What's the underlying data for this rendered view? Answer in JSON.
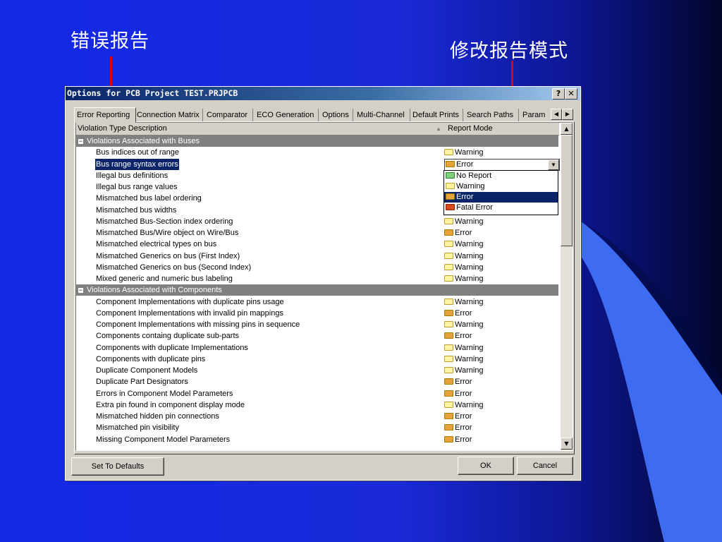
{
  "annotations": {
    "left_label": "错误报告",
    "right_label": "修改报告模式"
  },
  "window": {
    "title": "Options for PCB Project TEST.PRJPCB",
    "help_label": "?",
    "close_label": "✕"
  },
  "tabs": [
    {
      "label": "Error Reporting",
      "active": true
    },
    {
      "label": "Connection Matrix"
    },
    {
      "label": "Comparator"
    },
    {
      "label": "ECO Generation"
    },
    {
      "label": "Options"
    },
    {
      "label": "Multi-Channel"
    },
    {
      "label": "Default Prints"
    },
    {
      "label": "Search Paths"
    },
    {
      "label": "Param"
    }
  ],
  "columns": {
    "description": "Violation Type Description",
    "mode": "Report Mode"
  },
  "mode_colors": {
    "Warning": "#fff3a0",
    "Error": "#e8a23a",
    "No Report": "#7fcf7f",
    "Fatal Error": "#d94a1a"
  },
  "rows": [
    {
      "type": "group",
      "text": "Violations Associated with Buses"
    },
    {
      "text": "Bus indices out of range",
      "mode": "Warning"
    },
    {
      "text": "Bus range syntax errors",
      "mode": "Error",
      "selected": true
    },
    {
      "text": "Illegal bus definitions",
      "mode": ""
    },
    {
      "text": "Illegal bus range values",
      "mode": ""
    },
    {
      "text": "Mismatched bus label ordering",
      "mode": ""
    },
    {
      "text": "Mismatched bus widths",
      "mode": ""
    },
    {
      "text": "Mismatched Bus-Section index ordering",
      "mode": "Warning"
    },
    {
      "text": "Mismatched Bus/Wire object on Wire/Bus",
      "mode": "Error"
    },
    {
      "text": "Mismatched electrical types on bus",
      "mode": "Warning"
    },
    {
      "text": "Mismatched Generics on bus (First Index)",
      "mode": "Warning"
    },
    {
      "text": "Mismatched Generics on bus (Second Index)",
      "mode": "Warning"
    },
    {
      "text": "Mixed generic and numeric bus labeling",
      "mode": "Warning"
    },
    {
      "type": "group",
      "text": "Violations Associated with Components"
    },
    {
      "text": "Component Implementations with duplicate pins usage",
      "mode": "Warning"
    },
    {
      "text": "Component Implementations with invalid pin mappings",
      "mode": "Error"
    },
    {
      "text": "Component Implementations with missing pins in sequence",
      "mode": "Warning"
    },
    {
      "text": "Components containg duplicate sub-parts",
      "mode": "Error"
    },
    {
      "text": "Components with duplicate Implementations",
      "mode": "Warning"
    },
    {
      "text": "Components with duplicate pins",
      "mode": "Warning"
    },
    {
      "text": "Duplicate Component Models",
      "mode": "Warning"
    },
    {
      "text": "Duplicate Part Designators",
      "mode": "Error"
    },
    {
      "text": "Errors in Component Model Parameters",
      "mode": "Error"
    },
    {
      "text": "Extra pin found in component display mode",
      "mode": "Warning"
    },
    {
      "text": "Mismatched hidden pin connections",
      "mode": "Error"
    },
    {
      "text": "Mismatched pin visibility",
      "mode": "Error"
    },
    {
      "text": "Missing Component Model Parameters",
      "mode": "Error"
    }
  ],
  "dropdown": {
    "options": [
      "No Report",
      "Warning",
      "Error",
      "Fatal Error"
    ],
    "selected": "Error"
  },
  "buttons": {
    "defaults": "Set To Defaults",
    "ok": "OK",
    "cancel": "Cancel"
  }
}
